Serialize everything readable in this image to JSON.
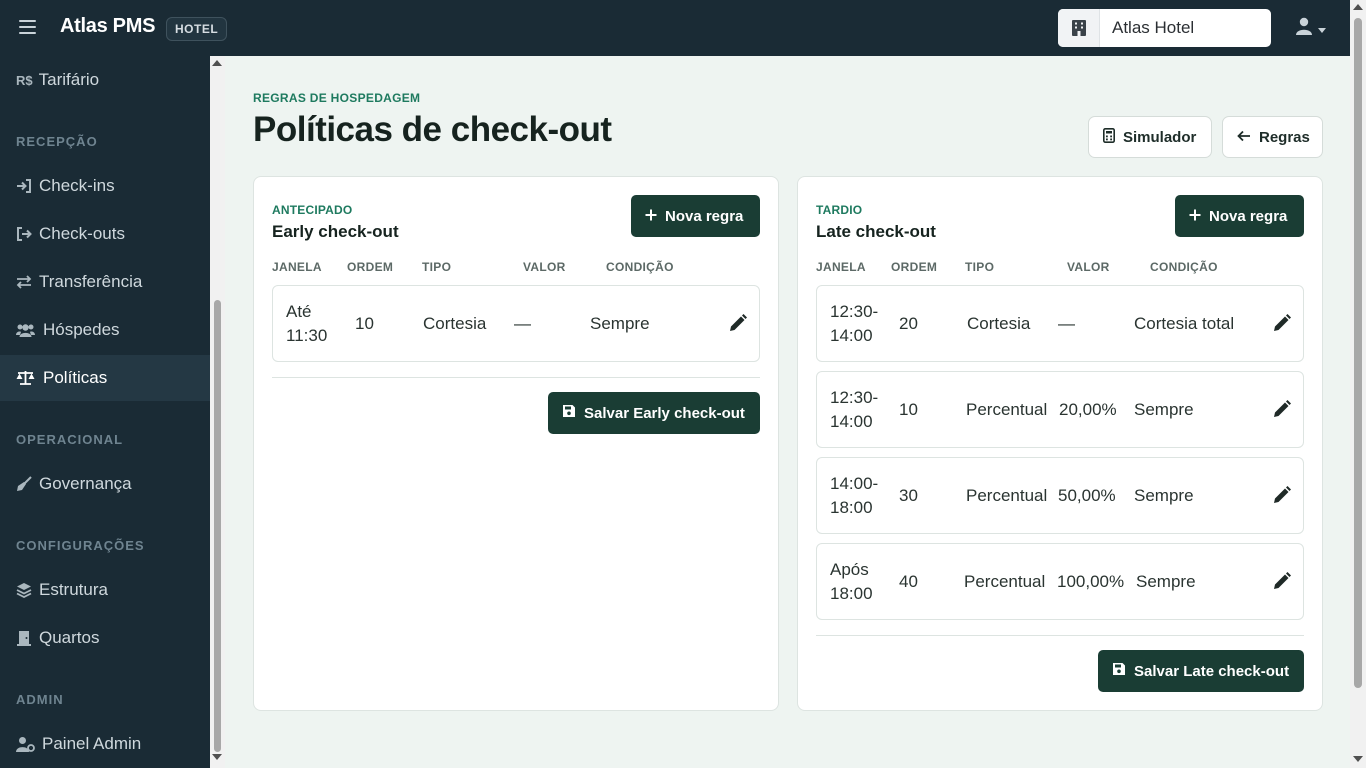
{
  "topbar": {
    "brand": "Atlas PMS",
    "badge": "HOTEL",
    "hotel_select": "Atlas Hotel"
  },
  "sidebar": {
    "items": [
      {
        "label": "Tarifário",
        "icon": "currency-brl-icon"
      },
      {
        "label": "Check-ins",
        "icon": "sign-in-icon"
      },
      {
        "label": "Check-outs",
        "icon": "sign-out-icon"
      },
      {
        "label": "Transferência",
        "icon": "arrows-swap-icon"
      },
      {
        "label": "Hóspedes",
        "icon": "users-icon"
      },
      {
        "label": "Políticas",
        "icon": "scale-icon",
        "active": true
      },
      {
        "label": "Governança",
        "icon": "broom-icon"
      },
      {
        "label": "Estrutura",
        "icon": "layers-icon"
      },
      {
        "label": "Quartos",
        "icon": "door-icon"
      },
      {
        "label": "Painel Admin",
        "icon": "user-gear-icon"
      }
    ],
    "sections": [
      "RECEPÇÃO",
      "OPERACIONAL",
      "CONFIGURAÇÕES",
      "ADMIN"
    ]
  },
  "header": {
    "eyebrow": "REGRAS DE HOSPEDAGEM",
    "title": "Políticas de check-out",
    "simulator_label": "Simulador",
    "rules_label": "Regras"
  },
  "columns": [
    "JANELA",
    "ORDEM",
    "TIPO",
    "VALOR",
    "CONDIÇÃO"
  ],
  "early": {
    "eyebrow": "ANTECIPADO",
    "title": "Early check-out",
    "new_rule_label": "Nova regra",
    "save_label": "Salvar Early check-out",
    "rows": [
      {
        "window_1": "Até",
        "window_2": "11:30",
        "order": "10",
        "type": "Cortesia",
        "value": "—",
        "condition": "Sempre"
      }
    ]
  },
  "late": {
    "eyebrow": "TARDIO",
    "title": "Late check-out",
    "new_rule_label": "Nova regra",
    "save_label": "Salvar Late check-out",
    "rows": [
      {
        "window_1": "12:30-",
        "window_2": "14:00",
        "order": "20",
        "type": "Cortesia",
        "value": "—",
        "condition": "Cortesia total"
      },
      {
        "window_1": "12:30-",
        "window_2": "14:00",
        "order": "10",
        "type": "Percentual",
        "value": "20,00%",
        "condition": "Sempre"
      },
      {
        "window_1": "14:00-",
        "window_2": "18:00",
        "order": "30",
        "type": "Percentual",
        "value": "50,00%",
        "condition": "Sempre"
      },
      {
        "window_1": "Após",
        "window_2": "18:00",
        "order": "40",
        "type": "Percentual",
        "value": "100,00%",
        "condition": "Sempre"
      }
    ]
  },
  "colors": {
    "sidebar_bg": "#1a2b35",
    "accent_green": "#1e7a5f",
    "button_dark": "#1a3d34"
  }
}
